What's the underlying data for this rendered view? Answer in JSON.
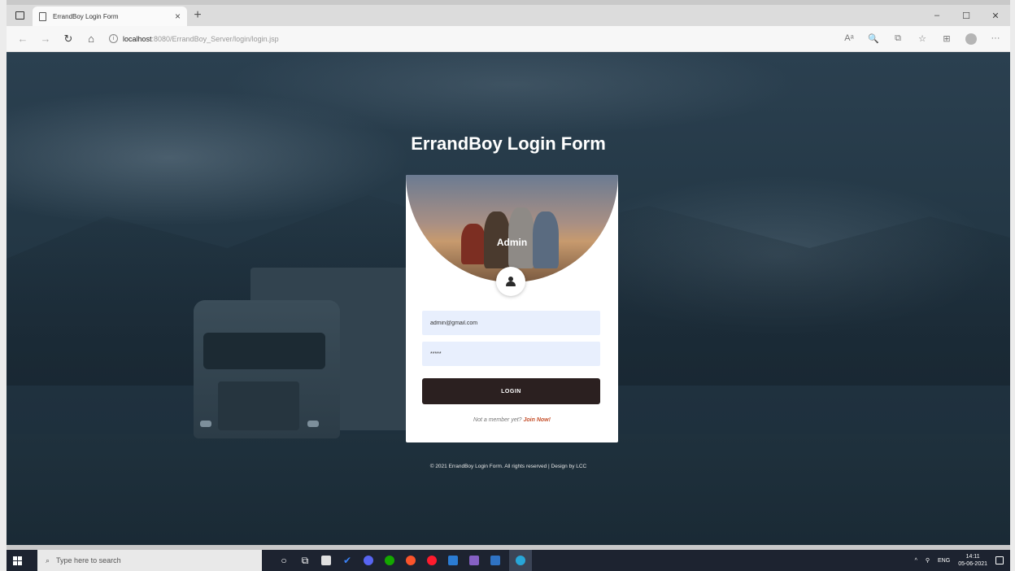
{
  "browser": {
    "tab_title": "ErrandBoy Login Form",
    "tab_close": "×",
    "new_tab": "+",
    "url_host": "localhost",
    "url_path": ":8080/ErrandBoy_Server/login/login.jsp",
    "nav": {
      "back": "←",
      "forward": "→",
      "refresh": "↻",
      "home": "⌂"
    },
    "window_controls": {
      "minimize": "–",
      "maximize": "☐",
      "close": "✕"
    },
    "toolbar_icons": {
      "read": "Aᵃ",
      "zoom": "🔍",
      "tab_actions": "⧉",
      "favorite": "☆",
      "collections": "⊞",
      "more": "···"
    }
  },
  "page": {
    "title": "ErrandBoy Login Form",
    "card": {
      "banner_label": "Admin",
      "email_value": "admin@gmail.com",
      "password_value": "*****",
      "login_label": "LOGIN",
      "register_prompt": "Not a member yet?",
      "register_link": "Join Now!"
    },
    "footer": "© 2021 ErrandBoy Login Form. All rights reserved | Design by LCC"
  },
  "taskbar": {
    "search_placeholder": "Type here to search",
    "search_icon": "⌕",
    "apps": [
      {
        "name": "cortana",
        "glyph": "○",
        "color": "#ffffff"
      },
      {
        "name": "task-view",
        "glyph": "⧉",
        "color": "#ffffff"
      },
      {
        "name": "store",
        "color": "#e0e0e0"
      },
      {
        "name": "todo",
        "color": "#3b82f6"
      },
      {
        "name": "discord",
        "color": "#5865f2"
      },
      {
        "name": "upwork",
        "color": "#14a800"
      },
      {
        "name": "brave",
        "color": "#fb542b"
      },
      {
        "name": "opera",
        "color": "#ff1b2d"
      },
      {
        "name": "word",
        "color": "#2b7cd3"
      },
      {
        "name": "visual-studio",
        "color": "#8661c5"
      },
      {
        "name": "virtualbox",
        "color": "#2f73c4"
      },
      {
        "name": "edge",
        "color": "#28a6d8"
      }
    ],
    "tray": {
      "chevron": "^",
      "network": "⚲",
      "language": "ENG",
      "time": "14:11",
      "date": "05-06-2021"
    }
  },
  "colors": {
    "page_bg": "#243846",
    "input_bg": "#e8effd",
    "button_bg": "#2b2020",
    "link": "#c54f2a",
    "taskbar": "#1d2330"
  }
}
